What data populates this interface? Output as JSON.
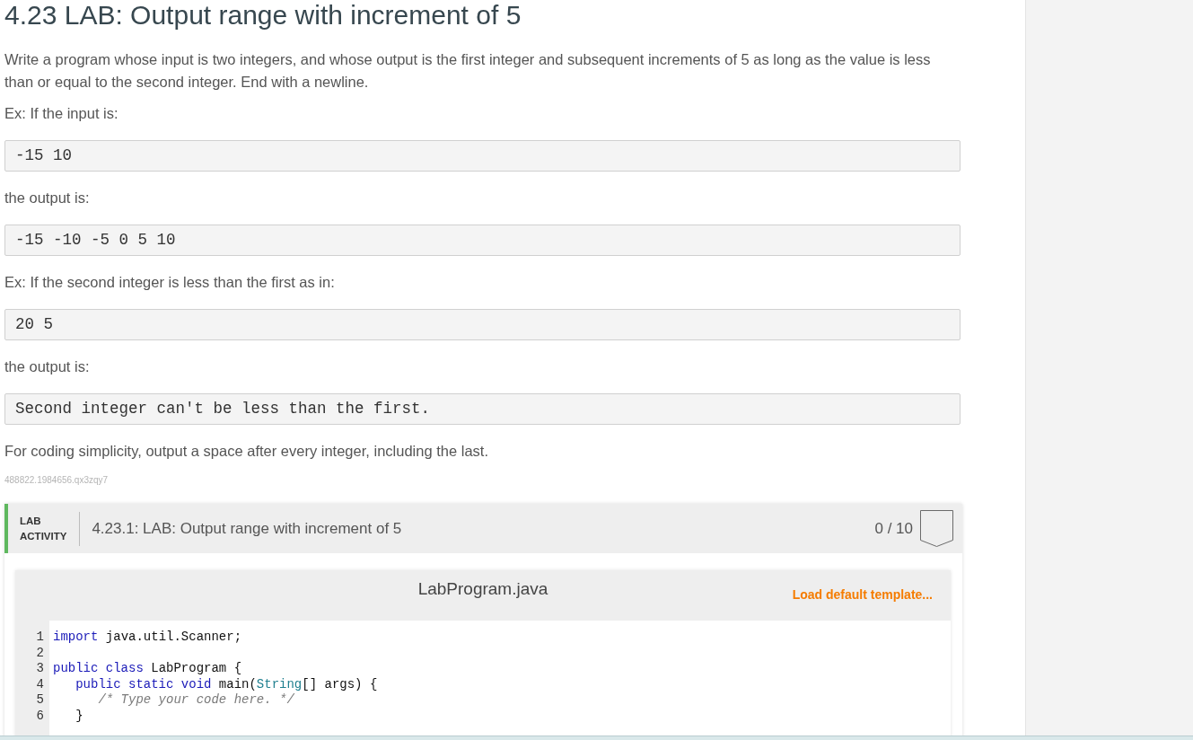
{
  "title": "4.23 LAB: Output range with increment of 5",
  "description": [
    {
      "kind": "paragraph",
      "text": "Write a program whose input is two integers, and whose output is the first integer and subsequent increments of 5 as long as the value is less than or equal to the second integer. End with a newline."
    },
    {
      "kind": "paragraph",
      "text": "Ex: If the input is:"
    },
    {
      "kind": "code",
      "text": "-15 10"
    },
    {
      "kind": "paragraph",
      "text": "the output is:"
    },
    {
      "kind": "code",
      "text": "-15 -10 -5 0 5 10"
    },
    {
      "kind": "paragraph",
      "text": "Ex: If the second integer is less than the first as in:"
    },
    {
      "kind": "code",
      "text": "20 5"
    },
    {
      "kind": "paragraph",
      "text": "the output is:"
    },
    {
      "kind": "code",
      "text": "Second integer can't be less than the first."
    },
    {
      "kind": "paragraph",
      "text": "For coding simplicity, output a space after every integer, including the last."
    },
    {
      "kind": "reference",
      "text": "488822.1984656.qx3zqy7"
    }
  ],
  "lab_activity": {
    "label": "LAB ACTIVITY",
    "title": "4.23.1: LAB: Output range with increment of 5",
    "score": "0 / 10",
    "completed": false
  },
  "editor": {
    "filename": "LabProgram.java",
    "load_template": "Load default template...",
    "lines": [
      {
        "number": "1",
        "tokens": [
          {
            "kind": "keyword",
            "text": "import"
          },
          {
            "kind": "plain",
            "text": " java.util.Scanner;"
          }
        ]
      },
      {
        "number": "2"
      },
      {
        "number": "3",
        "tokens": [
          {
            "kind": "keyword",
            "text": "public class"
          },
          {
            "kind": "plain",
            "text": " LabProgram {"
          }
        ]
      },
      {
        "number": "4",
        "tokens": [
          {
            "kind": "keyword",
            "text": "   public static void"
          },
          {
            "kind": "plain",
            "text": " main("
          },
          {
            "kind": "type",
            "text": "String"
          },
          {
            "kind": "plain",
            "text": "[] args) {"
          }
        ]
      },
      {
        "number": "5",
        "tokens": [
          {
            "kind": "comment",
            "text": "      /* Type your code here. */"
          }
        ]
      },
      {
        "number": "6",
        "tokens": [
          {
            "kind": "plain",
            "text": "   }"
          }
        ]
      }
    ]
  }
}
